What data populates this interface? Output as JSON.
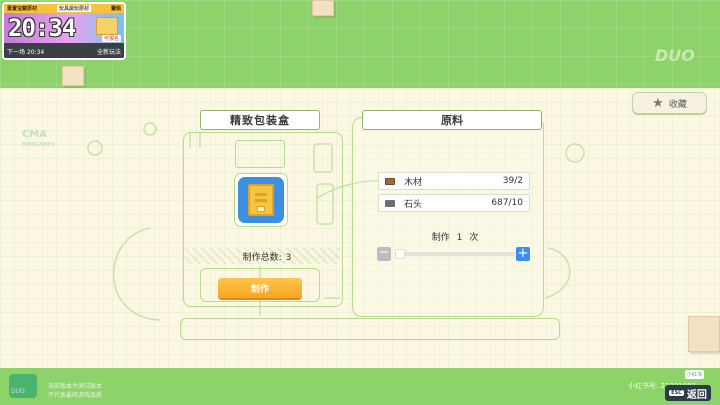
{
  "timer": {
    "tag_left": "重置宝藏原材",
    "tag_mid": "玩具屋玩原材",
    "tag_right": "蕾佩",
    "time": "20:34",
    "badge": "可报名",
    "next_label": "下一场",
    "next_time": "20:34",
    "mode": "全新玩法"
  },
  "decor": {
    "logo_top_right": "DUO",
    "logo_left_title": "CMA",
    "logo_left_sub": "MINIGAMES"
  },
  "collect": {
    "label": "收藏",
    "icon": "star-icon"
  },
  "item": {
    "title": "精致包装盒",
    "icon": "gift-box-icon",
    "total_label": "制作总数:",
    "total_value": "3",
    "make_label": "制作"
  },
  "materials": {
    "title": "原料",
    "rows": [
      {
        "icon": "wood-icon",
        "name": "木材",
        "count": "39/2"
      },
      {
        "icon": "stone-icon",
        "name": "石头",
        "count": "687/10"
      }
    ],
    "craft_label": "制作",
    "craft_count": "1",
    "craft_unit": "次",
    "minus": "−",
    "plus": "+",
    "slider_fraction": 0.0
  },
  "footer": {
    "notice_line1": "当前版本为测试版本",
    "notice_line2": "不代表最终游戏品质",
    "logo_text": "DUO",
    "small_tag": "小红书",
    "xhs_text": "小红书号: 2322198?",
    "esc_label": "ESC",
    "back_label": "返回"
  },
  "colors": {
    "background": "#8ed36a",
    "panel": "#fbf7e2",
    "accent_orange": "#f7a421",
    "accent_blue": "#3a8ef0"
  }
}
